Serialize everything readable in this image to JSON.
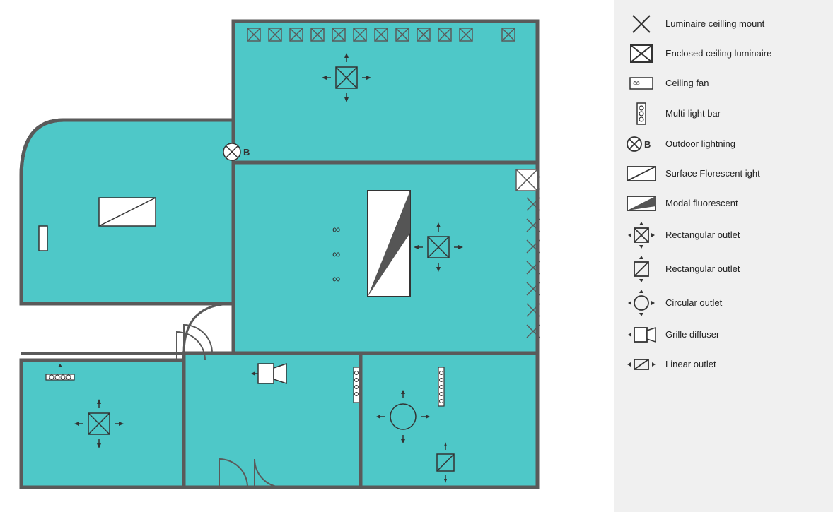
{
  "legend": {
    "items": [
      {
        "id": "luminaire-ceiling-mount",
        "label": "Luminaire ceilling mount",
        "icon": "x-square-open"
      },
      {
        "id": "enclosed-ceiling-luminaire",
        "label": "Enclosed ceiling luminaire",
        "icon": "x-square-filled"
      },
      {
        "id": "ceiling-fan",
        "label": "Ceiling fan",
        "icon": "infinity-square"
      },
      {
        "id": "multi-light-bar",
        "label": "Multi-light bar",
        "icon": "dots-bar"
      },
      {
        "id": "outdoor-lightning",
        "label": "Outdoor lightning",
        "icon": "x-circle-b"
      },
      {
        "id": "surface-florescent",
        "label": "Surface Florescent ight",
        "icon": "diagonal-rect"
      },
      {
        "id": "modal-fluorescent",
        "label": "Modal fluorescent",
        "icon": "triangle-rect"
      },
      {
        "id": "rectangular-outlet-1",
        "label": "Rectangular outlet",
        "icon": "x-square-arrows"
      },
      {
        "id": "rectangular-outlet-2",
        "label": "Rectangular outlet",
        "icon": "slash-square-arrows"
      },
      {
        "id": "circular-outlet",
        "label": "Circular outlet",
        "icon": "circle-arrows"
      },
      {
        "id": "grille-diffuser",
        "label": "Grille diffuser",
        "icon": "speaker-arrow"
      },
      {
        "id": "linear-outlet",
        "label": "Linear outlet",
        "icon": "slash-dash"
      }
    ]
  }
}
